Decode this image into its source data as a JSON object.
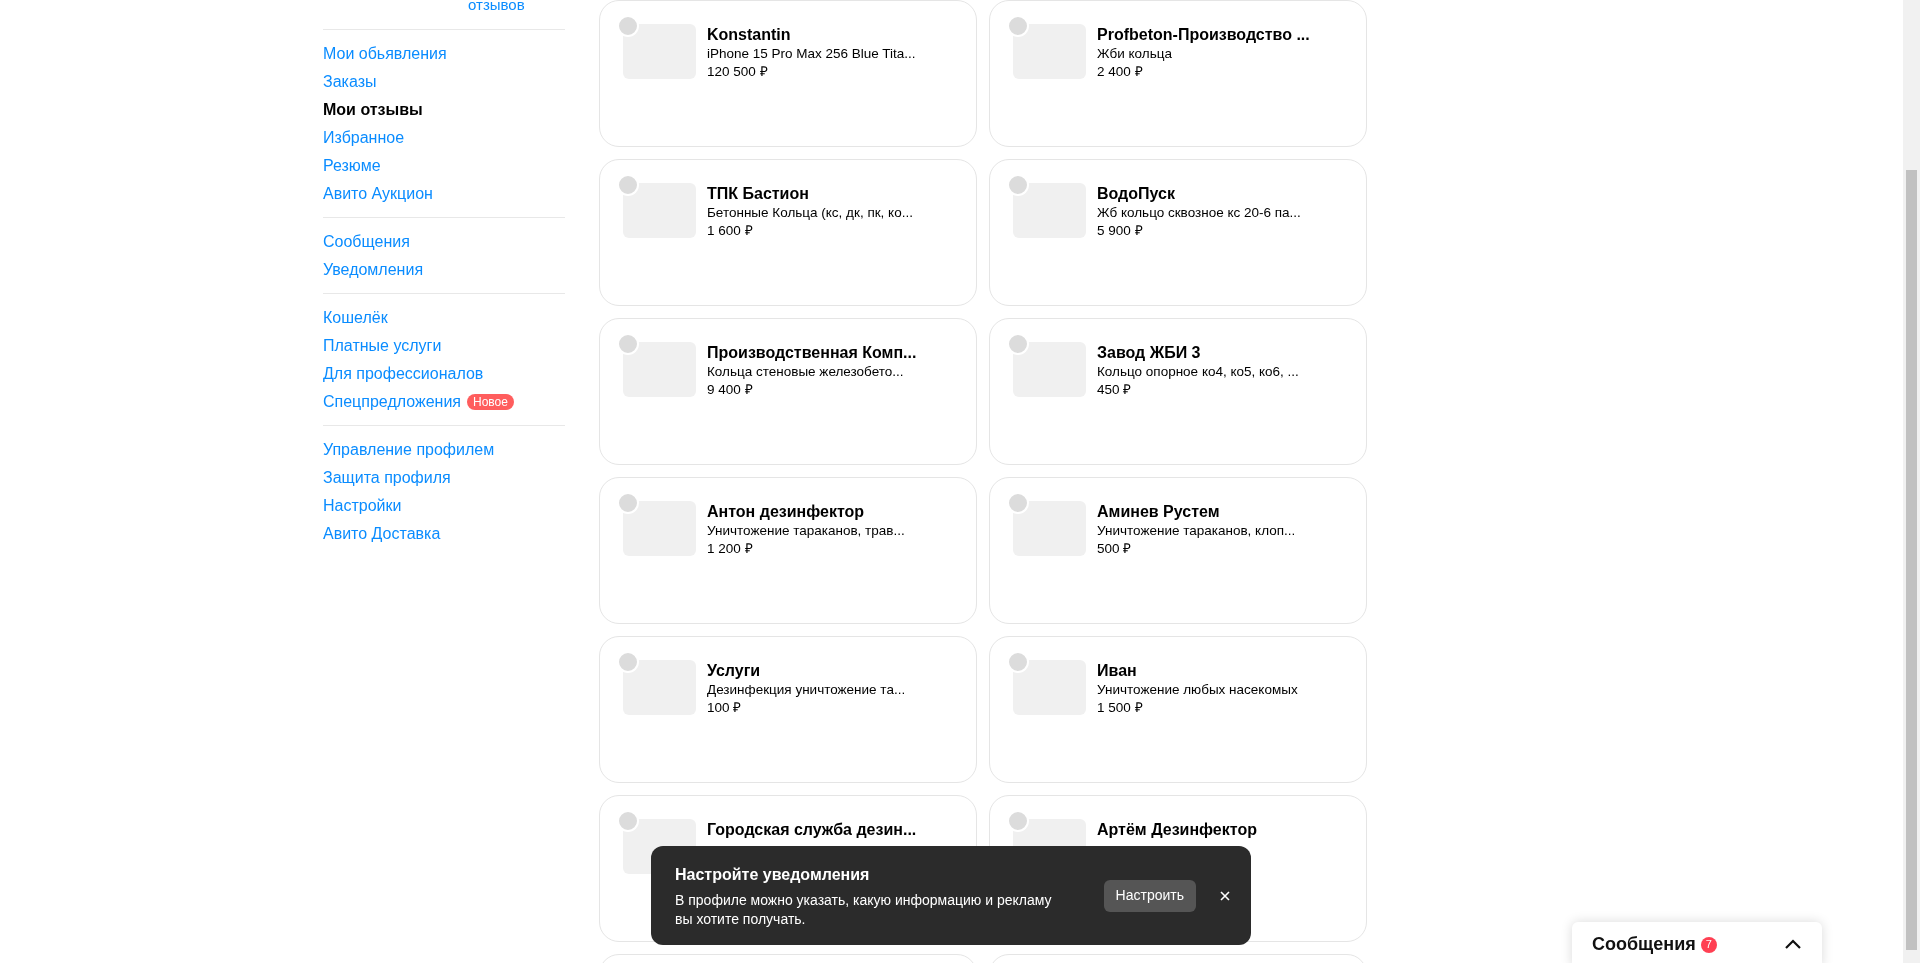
{
  "profile_header": {
    "reviews_link": "отзывов"
  },
  "sidebar": {
    "groups": [
      {
        "items": [
          {
            "label": "Мои обьявления",
            "selected": false
          },
          {
            "label": "Заказы",
            "selected": false
          },
          {
            "label": "Мои отзывы",
            "selected": true
          },
          {
            "label": "Избранное",
            "selected": false
          },
          {
            "label": "Резюме",
            "selected": false
          },
          {
            "label": "Авито Аукцион",
            "selected": false
          }
        ]
      },
      {
        "items": [
          {
            "label": "Сообщения",
            "selected": false
          },
          {
            "label": "Уведомления",
            "selected": false
          }
        ]
      },
      {
        "items": [
          {
            "label": "Кошелёк",
            "selected": false
          },
          {
            "label": "Платные услуги",
            "selected": false
          },
          {
            "label": "Для профессионалов",
            "selected": false
          },
          {
            "label": "Спецпредложения",
            "selected": false,
            "badge": "Новое"
          }
        ]
      },
      {
        "items": [
          {
            "label": "Управление профилем",
            "selected": false
          },
          {
            "label": "Защита профиля",
            "selected": false
          },
          {
            "label": "Настройки",
            "selected": false
          },
          {
            "label": "Авито Доставка",
            "selected": false
          }
        ]
      }
    ]
  },
  "cards": [
    {
      "kind": "full",
      "seller": "Konstantin",
      "title": "iPhone 15 Pro Max 256 Blue Tita...",
      "price": "120 500 ₽"
    },
    {
      "kind": "full",
      "seller": "Profbeton-Производство ...",
      "title": "Жби кольца",
      "price": "2 400 ₽"
    },
    {
      "kind": "full",
      "seller": "ТПК Бастион",
      "title": "Бетонные Кольца (кс, дк, пк, ко...",
      "price": "1 600 ₽"
    },
    {
      "kind": "full",
      "seller": "ВодоПуск",
      "title": "Жб кольцо сквозное кс 20-6 па...",
      "price": "5 900 ₽"
    },
    {
      "kind": "full",
      "seller": "Производственная Комп...",
      "title": "Кольца стеновые железобето...",
      "price": "9 400 ₽"
    },
    {
      "kind": "full",
      "seller": "Завод ЖБИ 3",
      "title": "Кольцо опорное ко4, ко5, ко6, ...",
      "price": "450 ₽"
    },
    {
      "kind": "full",
      "seller": "Антон дезинфектор",
      "title": "Уничтожение тараканов, трав...",
      "price": "1 200 ₽"
    },
    {
      "kind": "full",
      "seller": "Аминев Рустем",
      "title": "Уничтожение тараканов, клоп...",
      "price": "500 ₽"
    },
    {
      "kind": "full",
      "seller": "Услуги",
      "title": "Дезинфекция уничтожение та...",
      "price": "100 ₽"
    },
    {
      "kind": "full",
      "seller": "Иван",
      "title": "Уничтожение любых насекомых",
      "price": "1 500 ₽"
    },
    {
      "kind": "full",
      "seller": "Городская служба дезин..."
    },
    {
      "kind": "full",
      "seller": "Артём Дезинфектор"
    },
    {
      "kind": "edge"
    },
    {
      "kind": "edge"
    }
  ],
  "toast": {
    "title": "Настройте уведомления",
    "text": "В профиле можно указать, какую информацию и рекламу вы хотите получать.",
    "button": "Настроить"
  },
  "messages_widget": {
    "label": "Сообщения",
    "count": "7"
  }
}
